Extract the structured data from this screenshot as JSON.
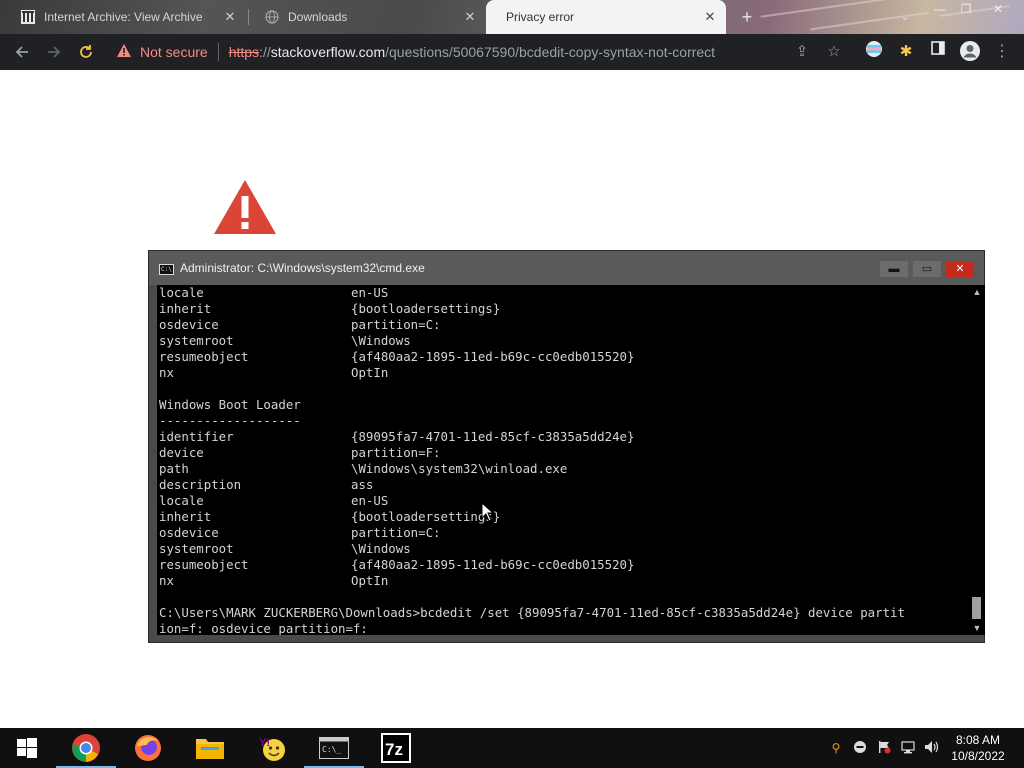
{
  "browser": {
    "tabs": [
      {
        "title": "Internet Archive: View Archive",
        "icon": "archive-icon",
        "active": false
      },
      {
        "title": "Downloads",
        "icon": "globe-icon",
        "active": false
      },
      {
        "title": "Privacy error",
        "icon": "",
        "active": true
      }
    ],
    "close_glyph": "✕",
    "new_tab_glyph": "+",
    "window_controls": [
      "—",
      "❐",
      "✕"
    ],
    "address": {
      "security_label": "Not secure",
      "scheme": "https",
      "separator": "://",
      "host": "stackoverflow.com",
      "path": "/questions/50067590/bcdedit-copy-syntax-not-correct"
    }
  },
  "cmd": {
    "title": "Administrator: C:\\Windows\\system32\\cmd.exe",
    "icon_text": "C:\\",
    "controls": [
      "▬",
      "▭",
      "✕"
    ],
    "lines": [
      {
        "key": "locale",
        "value": "en-US"
      },
      {
        "key": "inherit",
        "value": "{bootloadersettings}"
      },
      {
        "key": "osdevice",
        "value": "partition=C:"
      },
      {
        "key": "systemroot",
        "value": "\\Windows"
      },
      {
        "key": "resumeobject",
        "value": "{af480aa2-1895-11ed-b69c-cc0edb015520}"
      },
      {
        "key": "nx",
        "value": "OptIn"
      },
      {
        "key": "",
        "value": ""
      },
      {
        "key": "Windows Boot Loader",
        "value": ""
      },
      {
        "key": "-------------------",
        "value": ""
      },
      {
        "key": "identifier",
        "value": "{89095fa7-4701-11ed-85cf-c3835a5dd24e}"
      },
      {
        "key": "device",
        "value": "partition=F:"
      },
      {
        "key": "path",
        "value": "\\Windows\\system32\\winload.exe"
      },
      {
        "key": "description",
        "value": "ass"
      },
      {
        "key": "locale",
        "value": "en-US"
      },
      {
        "key": "inherit",
        "value": "{bootloadersettings}"
      },
      {
        "key": "osdevice",
        "value": "partition=C:"
      },
      {
        "key": "systemroot",
        "value": "\\Windows"
      },
      {
        "key": "resumeobject",
        "value": "{af480aa2-1895-11ed-b69c-cc0edb015520}"
      },
      {
        "key": "nx",
        "value": "OptIn"
      },
      {
        "key": "",
        "value": ""
      }
    ],
    "prompt_line_1": "C:\\Users\\MARK ZUCKERBERG\\Downloads>bcdedit /set {89095fa7-4701-11ed-85cf-c3835a5dd24e} device partit",
    "prompt_line_2": "ion=f: osdevice partition=f:",
    "scroll_up": "▲",
    "scroll_down": "▼"
  },
  "taskbar": {
    "apps": [
      "windows-start-icon",
      "chrome-icon",
      "firefox-icon",
      "file-explorer-icon",
      "yahoo-messenger-icon",
      "cmd-icon",
      "7zip-icon"
    ],
    "sevenzip_label": "7z",
    "cmd_label": "C:\\_",
    "tray": [
      "search-icon",
      "chat-icon",
      "flag-icon",
      "network-icon",
      "volume-icon"
    ],
    "time": "8:08 AM",
    "date": "10/8/2022"
  },
  "colors": {
    "warning_red": "#db4437",
    "not_secure": "#f28b82",
    "console_bg": "#000000",
    "console_fg": "#d4d4d4"
  }
}
